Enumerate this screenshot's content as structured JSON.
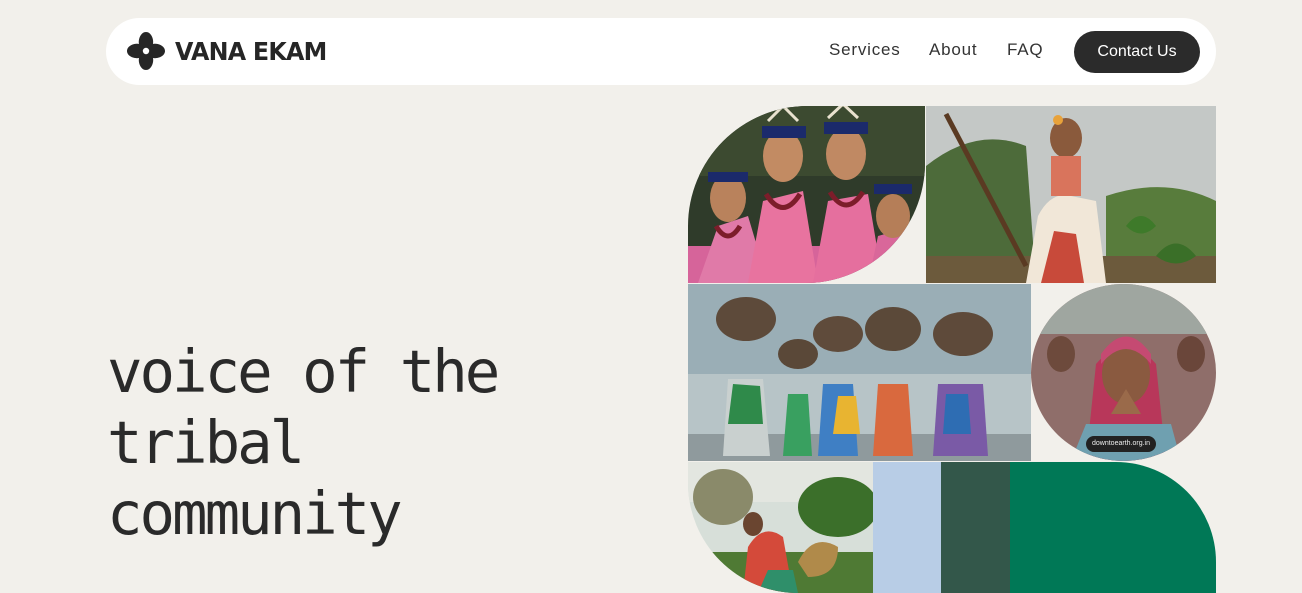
{
  "brand": {
    "name": "VANA EKAM"
  },
  "nav": {
    "services": "Services",
    "about": "About",
    "faq": "FAQ",
    "contact": "Contact Us"
  },
  "hero": {
    "line1": "voice of the",
    "line2": "tribal",
    "line3": "community"
  },
  "gallery": {
    "images": [
      "photo-tribal-women-headdresses",
      "photo-woman-farming-hoe",
      "photo-women-carrying-firewood",
      "photo-woman-folded-hands",
      "photo-man-harvesting-field"
    ],
    "watermark": "downtoearth.org.in"
  },
  "colors": {
    "background": "#f2f0eb",
    "nav_bg": "#ffffff",
    "button_bg": "#2b2b2b",
    "swatch_light_blue": "#b8cde6",
    "swatch_dark_green": "#33574a",
    "swatch_green": "#007856"
  }
}
